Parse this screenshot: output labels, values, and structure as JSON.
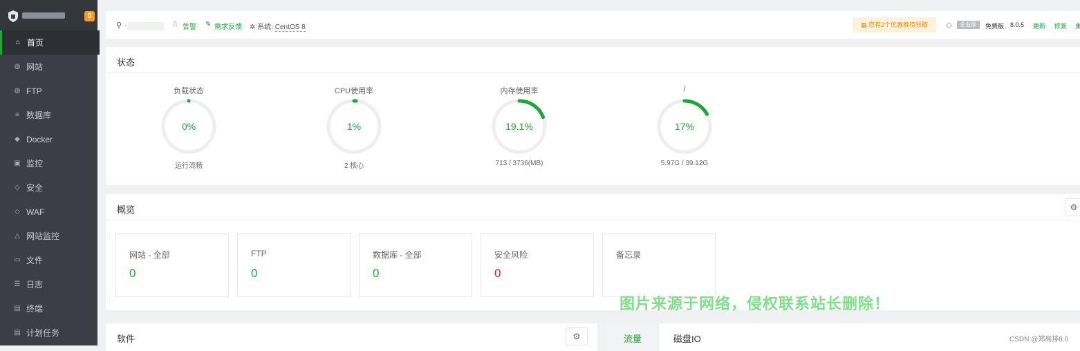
{
  "sidebar": {
    "badge": "0",
    "items": [
      {
        "label": "首页",
        "icon": "home-icon",
        "glyph": "⌂",
        "active": true
      },
      {
        "label": "网站",
        "icon": "globe-icon",
        "glyph": "◍"
      },
      {
        "label": "FTP",
        "icon": "ftp-icon",
        "glyph": "◍"
      },
      {
        "label": "数据库",
        "icon": "database-icon",
        "glyph": "≡"
      },
      {
        "label": "Docker",
        "icon": "docker-icon",
        "glyph": "◆"
      },
      {
        "label": "监控",
        "icon": "monitor-icon",
        "glyph": "▣"
      },
      {
        "label": "安全",
        "icon": "shield-icon",
        "glyph": "◇"
      },
      {
        "label": "WAF",
        "icon": "waf-icon",
        "glyph": "◇"
      },
      {
        "label": "网站监控",
        "icon": "site-monitor-icon",
        "glyph": "△"
      },
      {
        "label": "文件",
        "icon": "folder-icon",
        "glyph": "▭"
      },
      {
        "label": "日志",
        "icon": "log-icon",
        "glyph": "☰"
      },
      {
        "label": "终端",
        "icon": "terminal-icon",
        "glyph": "▤"
      },
      {
        "label": "计划任务",
        "icon": "cron-icon",
        "glyph": "▤"
      }
    ]
  },
  "header": {
    "user_sep": "·",
    "alarm": "告警",
    "feedback": "需求反馈",
    "sys_label": "系统:",
    "sys_value": "CentOS 8",
    "promo": "您有2个优惠券待领取",
    "edition_badge": "企业版",
    "free_edition": "免费版",
    "version": "8.0.5",
    "update": "更新",
    "repair": "修复",
    "restart": "重"
  },
  "status": {
    "title": "状态",
    "gauges": [
      {
        "label": "负载状态",
        "value": "0%",
        "percent": 0,
        "sub": "运行流畅"
      },
      {
        "label": "CPU使用率",
        "value": "1%",
        "percent": 1,
        "sub": "2 核心"
      },
      {
        "label": "内存使用率",
        "value": "19.1%",
        "percent": 19.1,
        "sub": "713 / 3736(MB)"
      },
      {
        "label": "/",
        "value": "17%",
        "percent": 17,
        "sub": "5.97G / 39.12G"
      }
    ]
  },
  "overview": {
    "title": "概览",
    "cards": [
      {
        "label": "网站 - 全部",
        "value": "0"
      },
      {
        "label": "FTP",
        "value": "0"
      },
      {
        "label": "数据库 - 全部",
        "value": "0"
      },
      {
        "label": "安全风险",
        "value": "0",
        "danger": true
      },
      {
        "label": "备忘录",
        "value": ""
      }
    ]
  },
  "software": {
    "title": "软件"
  },
  "traffic": {
    "tab_traffic": "流量",
    "tab_disk": "磁盘IO"
  },
  "watermark": "图片来源于网络，侵权联系站长删除！",
  "csdn_text": "CSDN @郑局排8.0",
  "colors": {
    "accent": "#20a53a",
    "danger": "#e02020",
    "sidebar": "#3b3f45"
  }
}
